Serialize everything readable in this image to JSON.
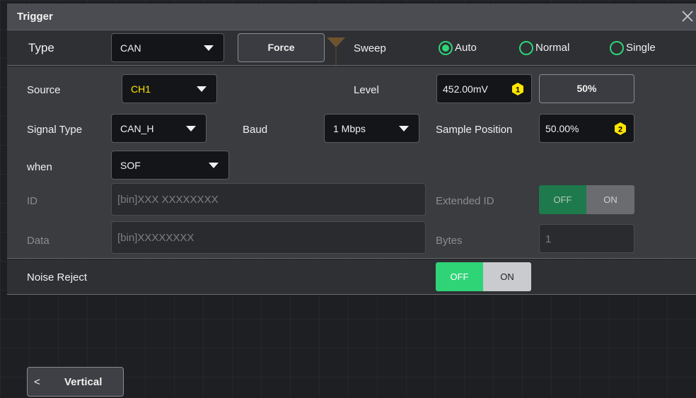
{
  "dialog": {
    "title": "Trigger"
  },
  "type_row": {
    "type_label": "Type",
    "type_value": "CAN",
    "force_label": "Force",
    "sweep_label": "Sweep",
    "sweep_options": [
      {
        "label": "Auto",
        "checked": true
      },
      {
        "label": "Normal",
        "checked": false
      },
      {
        "label": "Single",
        "checked": false
      }
    ]
  },
  "panel": {
    "source_label": "Source",
    "source_value": "CH1",
    "level_label": "Level",
    "level_value": "452.00mV",
    "level_badge": "1",
    "fifty_label": "50%",
    "signal_type_label": "Signal Type",
    "signal_type_value": "CAN_H",
    "baud_label": "Baud",
    "baud_value": "1 Mbps",
    "sample_position_label": "Sample Position",
    "sample_position_value": "50.00%",
    "sample_badge": "2",
    "when_label": "when",
    "when_value": "SOF",
    "id_label": "ID",
    "id_value": "[bin]XXX XXXXXXXX",
    "extended_id_label": "Extended ID",
    "extended_off": "OFF",
    "extended_on": "ON",
    "data_label": "Data",
    "data_value": "[bin]XXXXXXXX",
    "bytes_label": "Bytes",
    "bytes_value": "1"
  },
  "noise_row": {
    "label": "Noise Reject",
    "off": "OFF",
    "on": "ON"
  },
  "footer": {
    "vertical_label": "Vertical",
    "chevron": "<"
  },
  "colors": {
    "accent": "#2fd476",
    "badge": "#ffe600",
    "source": "#ffe600"
  }
}
